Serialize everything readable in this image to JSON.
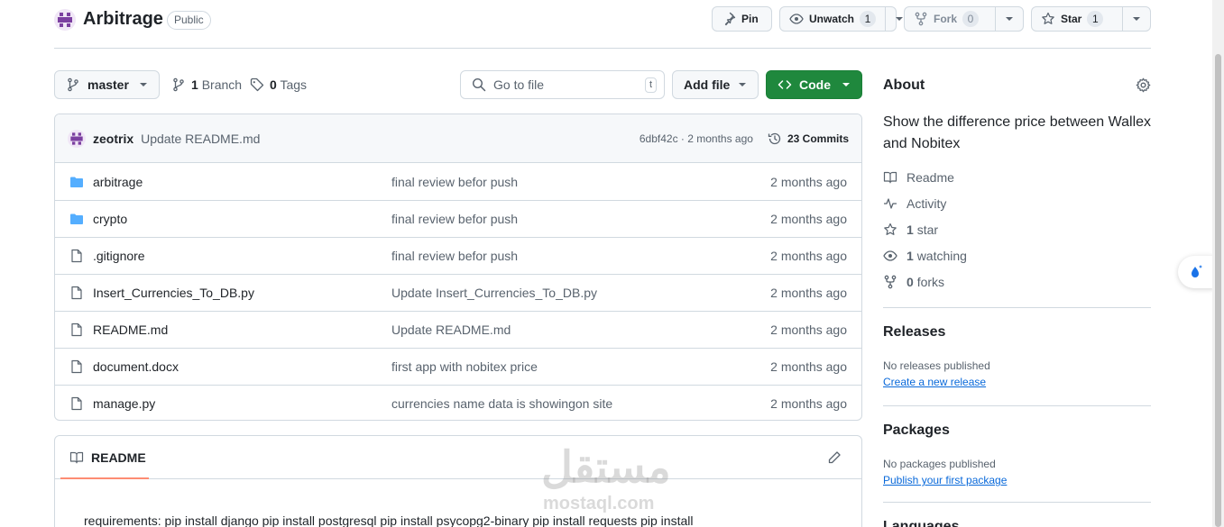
{
  "repo": {
    "name": "Arbitrage",
    "visibility": "Public"
  },
  "header_actions": {
    "pin_label": "Pin",
    "watch_label": "Unwatch",
    "watch_count": "1",
    "fork_label": "Fork",
    "fork_count": "0",
    "star_label": "Star",
    "star_count": "1"
  },
  "toolbar": {
    "branch": "master",
    "branch_count": "1",
    "branch_word": "Branch",
    "tag_count": "0",
    "tag_word": "Tags",
    "search_placeholder": "Go to file",
    "search_shortcut": "t",
    "add_file_label": "Add file",
    "code_label": "Code"
  },
  "latest_commit": {
    "author": "zeotrix",
    "message": "Update README.md",
    "meta": "6dbf42c · 2 months ago",
    "commits_label": "23 Commits"
  },
  "files": [
    {
      "type": "folder",
      "name": "arbitrage",
      "message": "final review befor push",
      "date": "2 months ago"
    },
    {
      "type": "folder",
      "name": "crypto",
      "message": "final review befor push",
      "date": "2 months ago"
    },
    {
      "type": "file",
      "name": ".gitignore",
      "message": "final review befor push",
      "date": "2 months ago"
    },
    {
      "type": "file",
      "name": "Insert_Currencies_To_DB.py",
      "message": "Update Insert_Currencies_To_DB.py",
      "date": "2 months ago"
    },
    {
      "type": "file",
      "name": "README.md",
      "message": "Update README.md",
      "date": "2 months ago"
    },
    {
      "type": "file",
      "name": "document.docx",
      "message": "first app with nobitex price",
      "date": "2 months ago"
    },
    {
      "type": "file",
      "name": "manage.py",
      "message": "currencies name data is showingon site",
      "date": "2 months ago"
    }
  ],
  "readme": {
    "tab_label": "README",
    "text": "requirements: pip install django pip install postgresql pip install psycopg2-binary pip install requests pip install"
  },
  "about": {
    "title": "About",
    "description": "Show the difference price between Wallex and Nobitex",
    "readme_label": "Readme",
    "activity_label": "Activity",
    "stars_count": "1",
    "stars_word": "star",
    "watching_count": "1",
    "watching_word": "watching",
    "forks_count": "0",
    "forks_word": "forks"
  },
  "releases": {
    "title": "Releases",
    "empty_text": "No releases published",
    "link": "Create a new release"
  },
  "packages": {
    "title": "Packages",
    "empty_text": "No packages published",
    "link": "Publish your first package"
  },
  "languages": {
    "title": "Languages"
  },
  "watermark": {
    "arabic": "مستقل",
    "latin": "mostaql.com"
  },
  "colors": {
    "accent_green": "#1f883d",
    "link_blue": "#0969da",
    "folder_blue": "#54aeff",
    "readme_underline": "#fd8c73"
  }
}
